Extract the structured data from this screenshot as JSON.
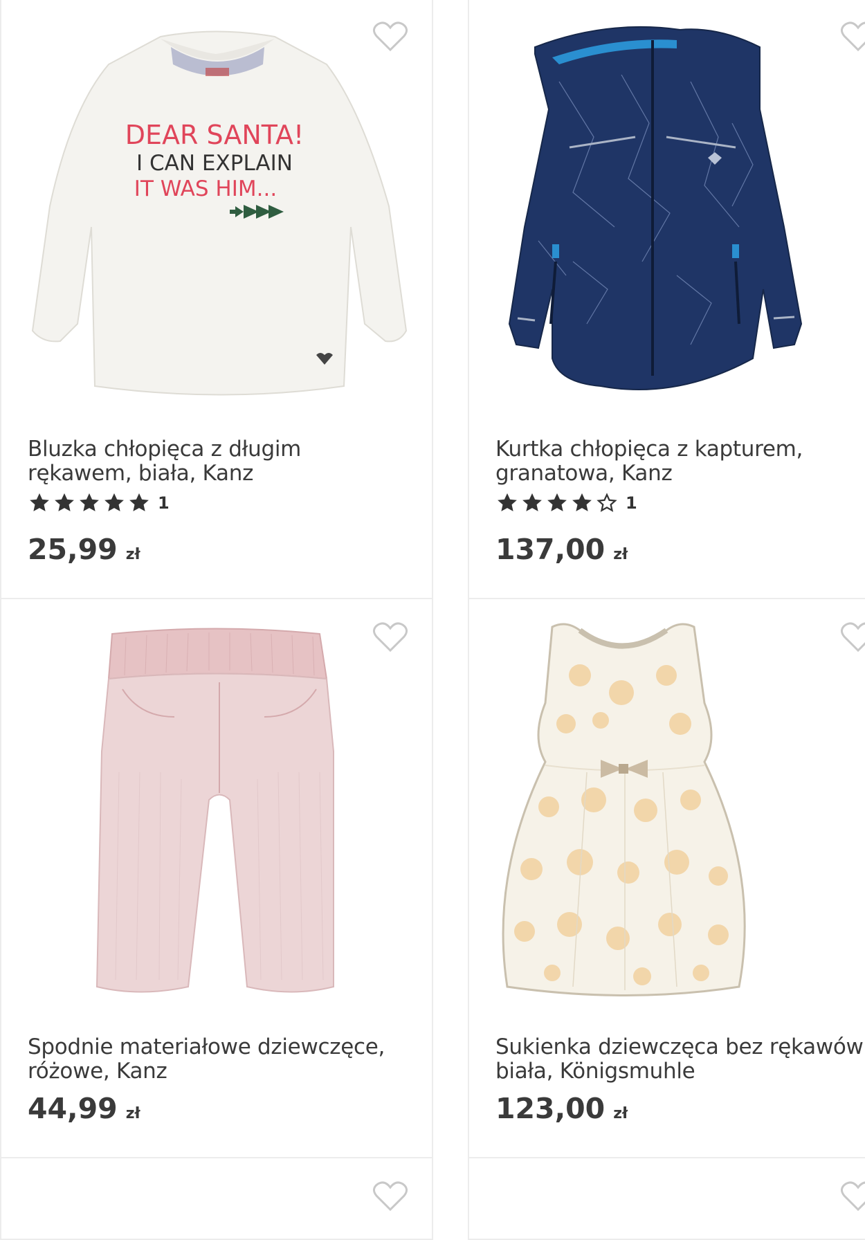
{
  "products": [
    {
      "title_line1": "Bluzka chłopięca z długim",
      "title_line2": "rękawem, biała, Kanz",
      "rating_stars": 5,
      "rating_count": "1",
      "price": "25,99",
      "currency": "zł",
      "image_icon": "white-long-sleeve-shirt",
      "print_line1": "DEAR SANTA!",
      "print_line2": "I CAN EXPLAIN",
      "print_line3": "IT WAS HIM..."
    },
    {
      "title_line1": "Kurtka chłopięca z kapturem,",
      "title_line2": "granatowa, Kanz",
      "rating_stars": 4,
      "rating_count": "1",
      "price": "137,00",
      "currency": "zł",
      "image_icon": "navy-hooded-jacket"
    },
    {
      "title_line1": "Spodnie materiałowe dziewczęce,",
      "title_line2": "różowe, Kanz",
      "price": "44,99",
      "currency": "zł",
      "image_icon": "pink-trousers"
    },
    {
      "title_line1": "Sukienka dziewczęca bez rękawów,",
      "title_line2": "biała, Königsmuhle",
      "price": "123,00",
      "currency": "zł",
      "image_icon": "white-floral-dress"
    }
  ],
  "colors": {
    "text": "#3a3a3a",
    "border": "#ececec",
    "heart_outline": "#c8c8c8",
    "star": "#333333"
  }
}
